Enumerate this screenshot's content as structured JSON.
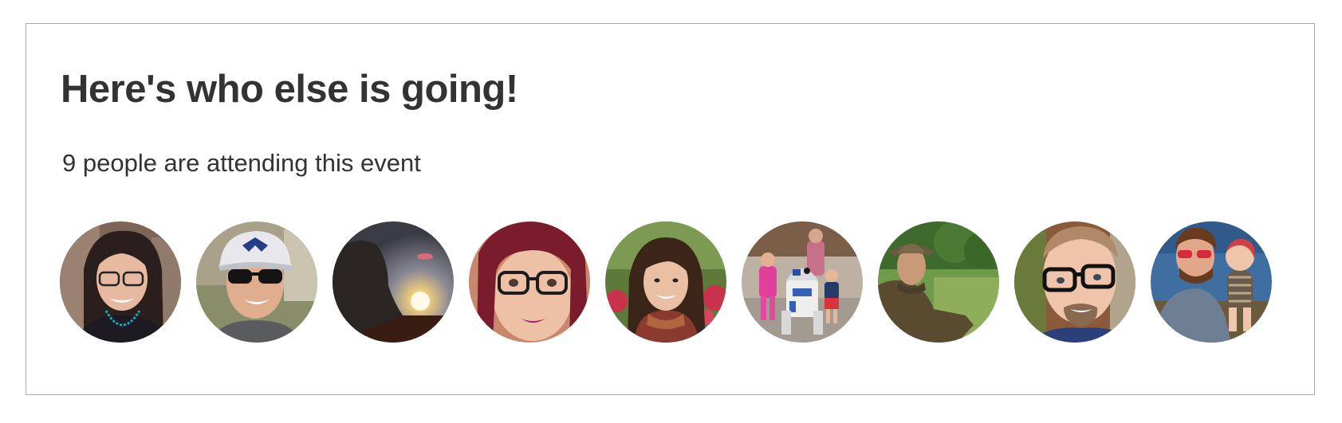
{
  "section": {
    "heading": "Here's who else is going!",
    "subtitle": "9 people are attending this event"
  },
  "attendees": [
    {
      "id": 1,
      "description": "smiling woman with glasses and turquoise necklace"
    },
    {
      "id": 2,
      "description": "man in cap and sunglasses"
    },
    {
      "id": 3,
      "description": "silhouette against setting sun"
    },
    {
      "id": 4,
      "description": "woman with red hair and dark glasses"
    },
    {
      "id": 5,
      "description": "smiling woman with curly hair and scarf"
    },
    {
      "id": 6,
      "description": "children next to a droid robot"
    },
    {
      "id": 7,
      "description": "man in hat sitting in a field"
    },
    {
      "id": 8,
      "description": "smiling man with glasses and beard"
    },
    {
      "id": 9,
      "description": "man in red sunglasses holding a toddler"
    }
  ],
  "colors": {
    "text": "#333333",
    "border": "#a9a9a9",
    "background": "#ffffff"
  }
}
